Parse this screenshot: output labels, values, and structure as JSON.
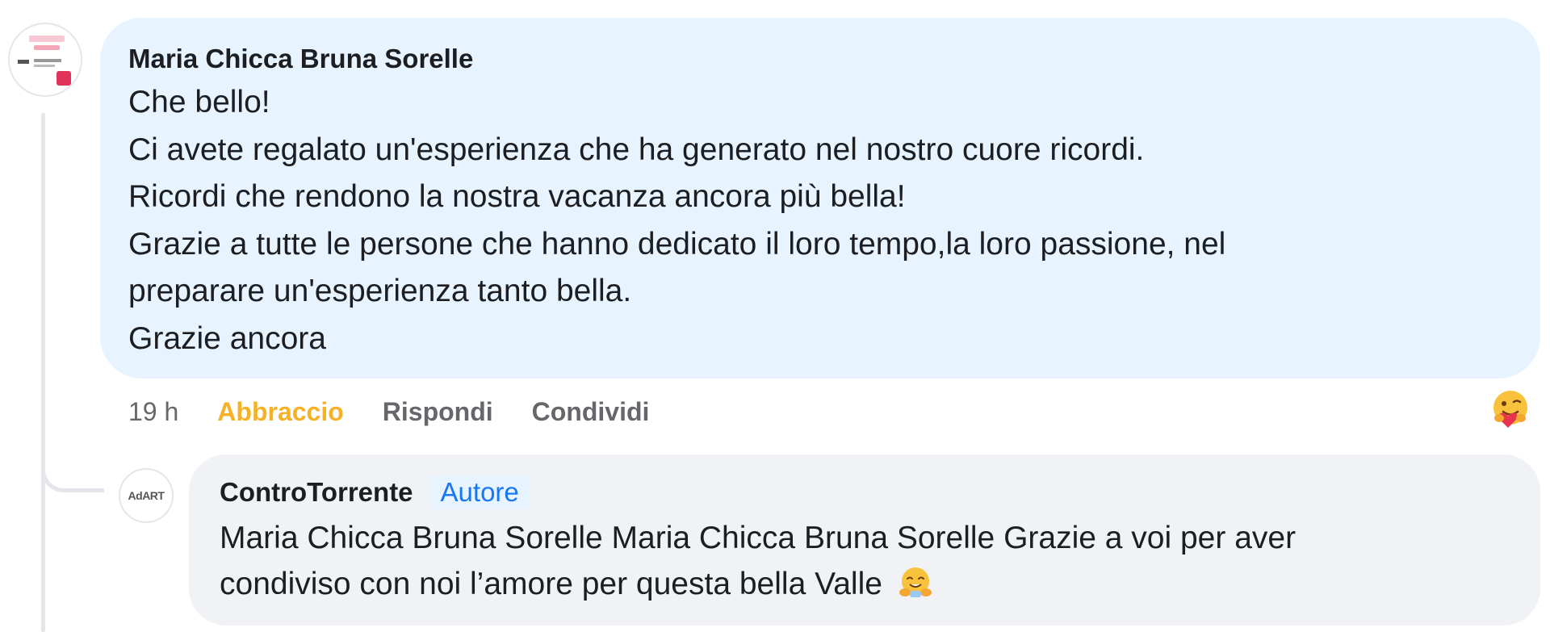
{
  "comment": {
    "author": "Maria Chicca Bruna Sorelle",
    "lines": [
      "Che bello!",
      "Ci avete regalato un'esperienza che ha generato nel nostro cuore ricordi.",
      "Ricordi che rendono la nostra vacanza ancora più bella!",
      "Grazie a tutte le persone che hanno dedicato il loro tempo,la loro passione, nel",
      "preparare un'esperienza tanto bella.",
      "Grazie ancora"
    ],
    "time": "19 h",
    "actions": {
      "react_label": "Abbraccio",
      "react_color": "#f7b125",
      "reply_label": "Rispondi",
      "share_label": "Condividi"
    },
    "reaction_icon": "hug-emoji-icon"
  },
  "reply": {
    "author": "ControTorrente",
    "author_badge": "Autore",
    "avatar_text": "AdART",
    "lines": [
      "Maria Chicca Bruna Sorelle Maria Chicca Bruna Sorelle Grazie a voi per aver",
      "condiviso con noi l’amore per questa bella Valle"
    ],
    "trailing_emoji": "hugging-face-emoji-icon"
  },
  "colors": {
    "bubble_primary": "#e7f3ff",
    "bubble_reply": "#f0f2f5",
    "badge_text": "#1877f2",
    "muted_text": "#65676b"
  }
}
